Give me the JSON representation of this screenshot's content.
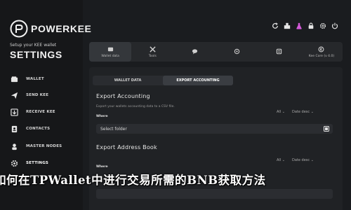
{
  "app": {
    "brand": "POWERKEE",
    "setup_subtitle": "Setup your KEE wallet",
    "settings_title": "SETTINGS"
  },
  "sidebar": {
    "items": [
      {
        "label": "WALLET",
        "icon": "wallet-icon"
      },
      {
        "label": "SEND KEE",
        "icon": "send-icon"
      },
      {
        "label": "RECEIVE KEE",
        "icon": "receive-icon"
      },
      {
        "label": "CONTACTS",
        "icon": "contacts-icon"
      },
      {
        "label": "MASTER NODES",
        "icon": "masternode-icon"
      },
      {
        "label": "SETTINGS",
        "icon": "settings-icon",
        "active": true
      }
    ]
  },
  "top_icons": [
    "refresh-icon",
    "vote-icon",
    "flask-icon",
    "lock-icon",
    "gear-icon",
    "quit-icon"
  ],
  "tabs": [
    {
      "label": "Wallet data",
      "icon": "wallet-data-icon",
      "active": true
    },
    {
      "label": "Tools",
      "icon": "tools-icon"
    },
    {
      "label": "",
      "icon": "chat-icon"
    },
    {
      "label": "",
      "icon": "network-icon"
    },
    {
      "label": "",
      "icon": "list-icon"
    },
    {
      "label": "Kee Core (v 4.0)",
      "icon": "core-icon"
    }
  ],
  "subtabs": [
    {
      "label": "WALLET DATA",
      "active": false
    },
    {
      "label": "EXPORT ACCOUNTING",
      "active": true
    }
  ],
  "export_accounting": {
    "title": "Export Accounting",
    "description": "Export your wallets accounting data to a CSV file.",
    "where_label": "Where",
    "filter_all": "All",
    "filter_sort": "Date desc",
    "folder_placeholder": "Select folder"
  },
  "export_address_book": {
    "title": "Export Address Book",
    "where_label": "Where",
    "filter_all": "All",
    "filter_sort": "Date desc"
  },
  "overlay_headline": "如何在TPWallet中进行交易所需的BNB获取方法",
  "colors": {
    "background": "#1a1c1f",
    "sidebar": "#161719",
    "panel": "#202225",
    "accent_flask": "#d45ad9"
  }
}
